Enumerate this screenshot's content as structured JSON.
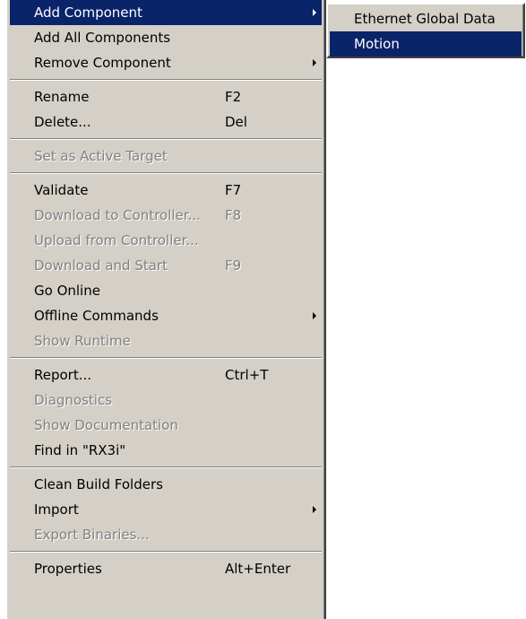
{
  "context_menu": {
    "groups": [
      [
        {
          "label": "Add Component",
          "shortcut": "",
          "submenu": true,
          "enabled": true,
          "highlighted": true
        },
        {
          "label": "Add All Components",
          "shortcut": "",
          "submenu": false,
          "enabled": true,
          "highlighted": false
        },
        {
          "label": "Remove Component",
          "shortcut": "",
          "submenu": true,
          "enabled": true,
          "highlighted": false
        }
      ],
      [
        {
          "label": "Rename",
          "shortcut": "F2",
          "submenu": false,
          "enabled": true,
          "highlighted": false
        },
        {
          "label": "Delete...",
          "shortcut": "Del",
          "submenu": false,
          "enabled": true,
          "highlighted": false
        }
      ],
      [
        {
          "label": "Set as Active Target",
          "shortcut": "",
          "submenu": false,
          "enabled": false,
          "highlighted": false
        }
      ],
      [
        {
          "label": "Validate",
          "shortcut": "F7",
          "submenu": false,
          "enabled": true,
          "highlighted": false
        },
        {
          "label": "Download to Controller...",
          "shortcut": "F8",
          "submenu": false,
          "enabled": false,
          "highlighted": false
        },
        {
          "label": "Upload from Controller...",
          "shortcut": "",
          "submenu": false,
          "enabled": false,
          "highlighted": false
        },
        {
          "label": "Download and Start",
          "shortcut": "F9",
          "submenu": false,
          "enabled": false,
          "highlighted": false
        },
        {
          "label": "Go Online",
          "shortcut": "",
          "submenu": false,
          "enabled": true,
          "highlighted": false
        },
        {
          "label": "Offline Commands",
          "shortcut": "",
          "submenu": true,
          "enabled": true,
          "highlighted": false
        },
        {
          "label": "Show Runtime",
          "shortcut": "",
          "submenu": false,
          "enabled": false,
          "highlighted": false
        }
      ],
      [
        {
          "label": "Report...",
          "shortcut": "Ctrl+T",
          "submenu": false,
          "enabled": true,
          "highlighted": false
        },
        {
          "label": "Diagnostics",
          "shortcut": "",
          "submenu": false,
          "enabled": false,
          "highlighted": false
        },
        {
          "label": "Show Documentation",
          "shortcut": "",
          "submenu": false,
          "enabled": false,
          "highlighted": false
        },
        {
          "label": "Find in \"RX3i\"",
          "shortcut": "",
          "submenu": false,
          "enabled": true,
          "highlighted": false
        }
      ],
      [
        {
          "label": "Clean Build Folders",
          "shortcut": "",
          "submenu": false,
          "enabled": true,
          "highlighted": false
        },
        {
          "label": "Import",
          "shortcut": "",
          "submenu": true,
          "enabled": true,
          "highlighted": false
        },
        {
          "label": "Export Binaries...",
          "shortcut": "",
          "submenu": false,
          "enabled": false,
          "highlighted": false
        }
      ],
      [
        {
          "label": "Properties",
          "shortcut": "Alt+Enter",
          "submenu": false,
          "enabled": true,
          "highlighted": false
        }
      ]
    ]
  },
  "submenu": {
    "items": [
      {
        "label": "Ethernet Global Data",
        "highlighted": false
      },
      {
        "label": "Motion",
        "highlighted": true
      }
    ]
  },
  "colors": {
    "menu_background": "#d4d0c8",
    "highlight": "#0a246a",
    "highlight_text": "#ffffff",
    "disabled_text": "#808080"
  }
}
